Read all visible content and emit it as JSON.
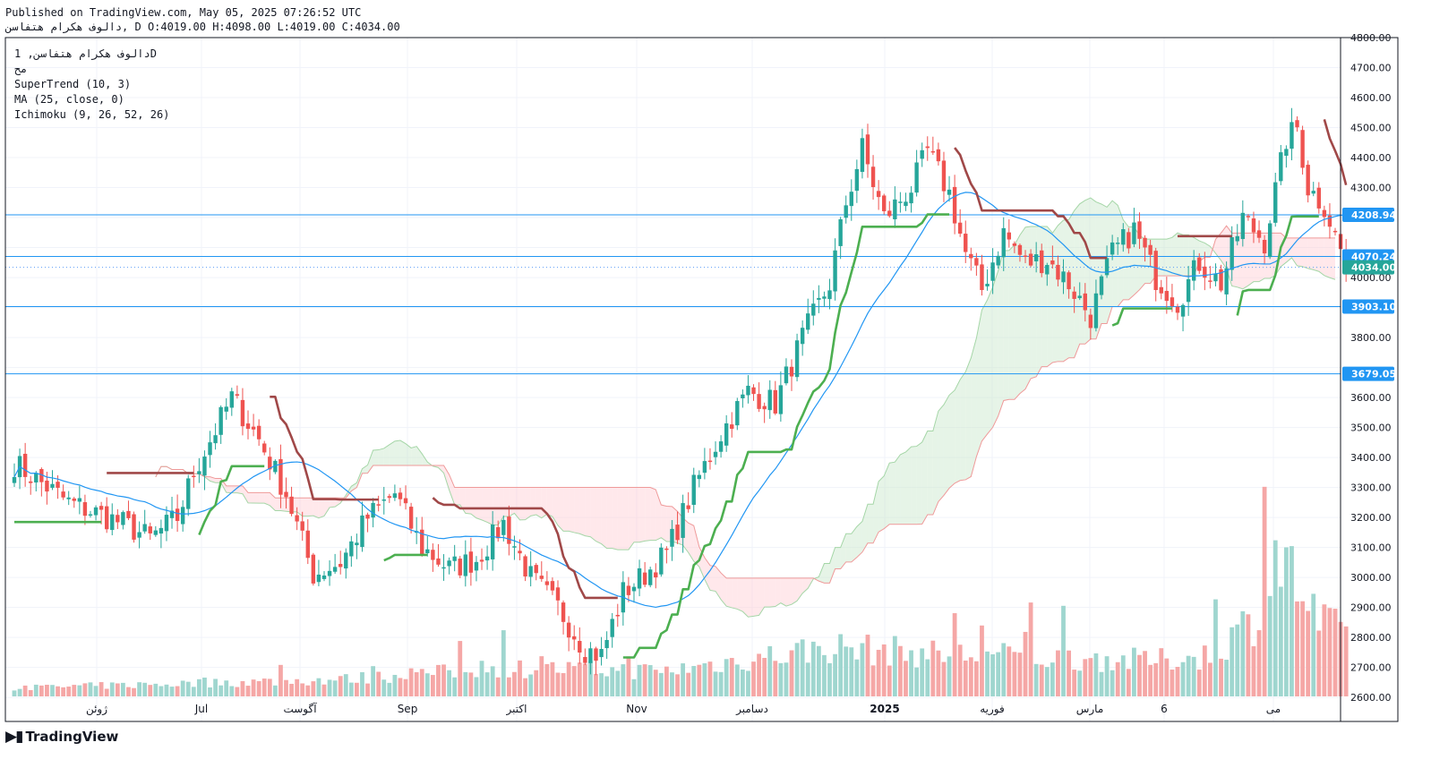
{
  "header": {
    "published": "Published on TradingView.com, May 05, 2025 07:26:52 UTC",
    "ohlc_line": "دالوف هکرام هتفاسن, D O:4019.00 H:4098.00 L:4019.00 C:4034.00"
  },
  "legend": {
    "symbol": "دالوف هکرام هتفاسن, 1D",
    "exchange": "مح",
    "supertrend": "SuperTrend (10, 3)",
    "ma": "MA (25, close, 0)",
    "ichimoku": "Ichimoku (9, 26, 52, 26)"
  },
  "brand": {
    "name": "TradingView"
  },
  "colors": {
    "up": "#26a69a",
    "down": "#ef5350",
    "supertrend_up": "#4caf50",
    "supertrend_down": "#a04848",
    "ma": "#2196f3",
    "level": "#2196f3",
    "cloud_bull": "#c8e6c9",
    "cloud_bear": "#ffcdd2"
  },
  "chart_data": {
    "type": "candlestick",
    "y_range": [
      2520,
      4800
    ],
    "y_ticks": [
      "4800.00",
      "4700.00",
      "4600.00",
      "4500.00",
      "4400.00",
      "4300.00",
      "4000.00",
      "3800.00",
      "3600.00",
      "3500.00",
      "3400.00",
      "3300.00",
      "3200.00",
      "3100.00",
      "3000.00",
      "2900.00",
      "2800.00",
      "2700.00",
      "2600.00"
    ],
    "x_labels": [
      "ژوئن",
      "Jul",
      "آگوست",
      "Sep",
      "اکتبر",
      "Nov",
      "دسامبر",
      "2025",
      "فوریه",
      "مارس",
      "6",
      "می"
    ],
    "levels": [
      {
        "value": "4208.94",
        "style": "solid"
      },
      {
        "value": "4070.24",
        "style": "solid"
      },
      {
        "value": "4034.00",
        "style": "dotted"
      },
      {
        "value": "3903.10",
        "style": "solid"
      },
      {
        "value": "3679.05",
        "style": "solid"
      }
    ],
    "last_close": 4034.0,
    "anchors": [
      [
        0,
        3380
      ],
      [
        10,
        3250
      ],
      [
        20,
        3180
      ],
      [
        25,
        3130
      ],
      [
        30,
        3200
      ],
      [
        33,
        3350
      ],
      [
        40,
        3600
      ],
      [
        45,
        3460
      ],
      [
        50,
        3280
      ],
      [
        55,
        3010
      ],
      [
        60,
        3050
      ],
      [
        65,
        3200
      ],
      [
        70,
        3280
      ],
      [
        75,
        3100
      ],
      [
        80,
        3030
      ],
      [
        85,
        3060
      ],
      [
        90,
        3180
      ],
      [
        95,
        3000
      ],
      [
        100,
        2900
      ],
      [
        105,
        2760
      ],
      [
        108,
        2740
      ],
      [
        112,
        2950
      ],
      [
        116,
        3010
      ],
      [
        120,
        3080
      ],
      [
        125,
        3300
      ],
      [
        130,
        3480
      ],
      [
        135,
        3620
      ],
      [
        140,
        3580
      ],
      [
        145,
        3800
      ],
      [
        150,
        3980
      ],
      [
        153,
        4250
      ],
      [
        156,
        4430
      ],
      [
        160,
        4200
      ],
      [
        165,
        4300
      ],
      [
        168,
        4420
      ],
      [
        172,
        4280
      ],
      [
        175,
        4080
      ],
      [
        178,
        3960
      ],
      [
        182,
        4150
      ],
      [
        186,
        4050
      ],
      [
        190,
        4060
      ],
      [
        194,
        3980
      ],
      [
        198,
        3870
      ],
      [
        202,
        4080
      ],
      [
        206,
        4160
      ],
      [
        210,
        4000
      ],
      [
        214,
        3920
      ],
      [
        218,
        4050
      ],
      [
        222,
        3980
      ],
      [
        226,
        4200
      ],
      [
        230,
        4120
      ],
      [
        234,
        4460
      ],
      [
        236,
        4500
      ],
      [
        238,
        4300
      ],
      [
        241,
        4240
      ],
      [
        245,
        4040
      ]
    ],
    "volume_anchors": [
      [
        0,
        0.06
      ],
      [
        20,
        0.08
      ],
      [
        40,
        0.1
      ],
      [
        60,
        0.12
      ],
      [
        90,
        0.2
      ],
      [
        120,
        0.18
      ],
      [
        150,
        0.35
      ],
      [
        170,
        0.3
      ],
      [
        190,
        0.28
      ],
      [
        210,
        0.25
      ],
      [
        220,
        0.3
      ],
      [
        228,
        0.55
      ],
      [
        232,
        1.0
      ],
      [
        236,
        0.8
      ],
      [
        240,
        0.5
      ],
      [
        245,
        0.45
      ]
    ]
  }
}
